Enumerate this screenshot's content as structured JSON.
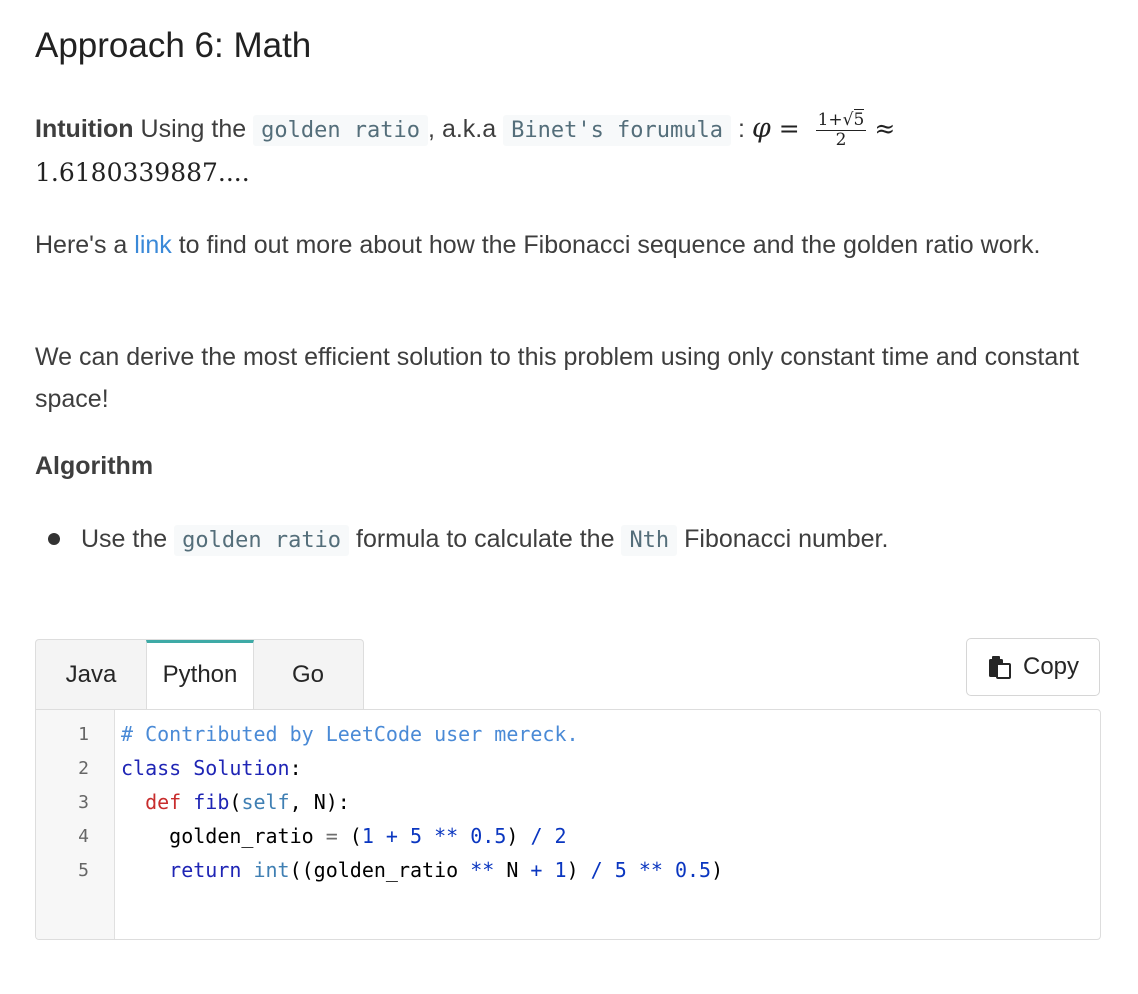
{
  "title": "Approach 6: Math",
  "intuition": {
    "label": "Intuition",
    "text1": " Using the ",
    "code1": "golden ratio",
    "text2": ", a.k.a ",
    "code2": "Binet's forumula",
    "text3": " : ",
    "phi": "φ",
    "equals": " = ",
    "frac_num_a": "1+",
    "frac_num_sqrt": "5",
    "frac_den": "2",
    "approx": "≈",
    "value": "1.6180339887...."
  },
  "link_para": {
    "before": "Here's a ",
    "link": "link",
    "after": " to find out more about how the Fibonacci sequence and the golden ratio work."
  },
  "derive_para": "We can derive the most efficient solution to this problem using only constant time and constant space!",
  "algorithm": {
    "heading": "Algorithm",
    "bullet_before": "Use the ",
    "bullet_code1": "golden ratio",
    "bullet_mid": " formula to calculate the ",
    "bullet_code2": "Nth",
    "bullet_after": " Fibonacci number."
  },
  "code_tabs": [
    "Java",
    "Python",
    "Go"
  ],
  "active_tab": "Python",
  "copy_label": "Copy",
  "code": {
    "line_numbers": [
      "1",
      "2",
      "3",
      "4",
      "5"
    ],
    "l1_comment": "# Contributed by LeetCode user mereck.",
    "l2_kw": "class",
    "l2_name": " Solution",
    "l2_colon": ":",
    "l3_indent": "  ",
    "l3_kw": "def",
    "l3_name": " fib",
    "l3_open": "(",
    "l3_self": "self",
    "l3_rest": ", N):",
    "l4_indent": "    ",
    "l4_var": "golden_ratio",
    "l4_eq": " = ",
    "l4_open": "(",
    "l4_n1": "1",
    "l4_plus": " + ",
    "l4_n2": "5",
    "l4_pow": " ** ",
    "l4_n3": "0.5",
    "l4_close": ")",
    "l4_div": " / ",
    "l4_n4": "2",
    "l5_indent": "    ",
    "l5_kw": "return",
    "l5_sp": " ",
    "l5_int": "int",
    "l5_open": "((golden_ratio",
    "l5_pow": " ** ",
    "l5_n": "N",
    "l5_plus": " + ",
    "l5_n1": "1",
    "l5_close": ")",
    "l5_div": " / ",
    "l5_n2": "5",
    "l5_pow2": " ** ",
    "l5_n3": "0.5",
    "l5_end": ")"
  },
  "colors": {
    "link": "#3a89d8",
    "tab_accent": "#3eaaa6",
    "comment": "#4a8ad6",
    "keyword": "#1f25b5",
    "def": "#c82d2d"
  }
}
